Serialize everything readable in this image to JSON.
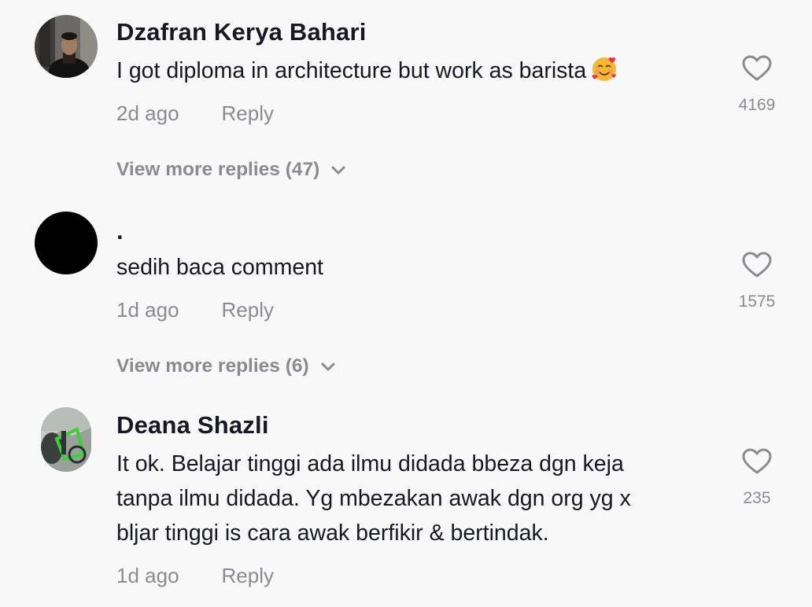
{
  "comments": [
    {
      "author": "Dzafran Kerya Bahari",
      "text_lines": [
        "I got diploma in architecture but work as barista"
      ],
      "emoji": "smiling-face-with-hearts",
      "time": "2d ago",
      "reply_label": "Reply",
      "likes": "4169",
      "view_more": "View more replies (47)"
    },
    {
      "author": ".",
      "text_lines": [
        "sedih baca comment"
      ],
      "time": "1d ago",
      "reply_label": "Reply",
      "likes": "1575",
      "view_more": "View more replies (6)"
    },
    {
      "author": "Deana Shazli",
      "text_lines": [
        "It ok. Belajar tinggi ada ilmu didada bbeza dgn keja",
        "tanpa ilmu didada. Yg mbezakan awak dgn org yg x",
        "bljar tinggi is cara awak berfikir & bertindak."
      ],
      "time": "1d ago",
      "reply_label": "Reply",
      "likes": "235"
    }
  ],
  "icons": {
    "like": "heart-outline-icon",
    "expand": "chevron-down-icon"
  },
  "colors": {
    "background": "#f8f8f8",
    "primary_text": "#161823",
    "secondary_text": "#8a8b91",
    "emoji_face": "#f7b733",
    "emoji_hearts": "#e8364a"
  }
}
